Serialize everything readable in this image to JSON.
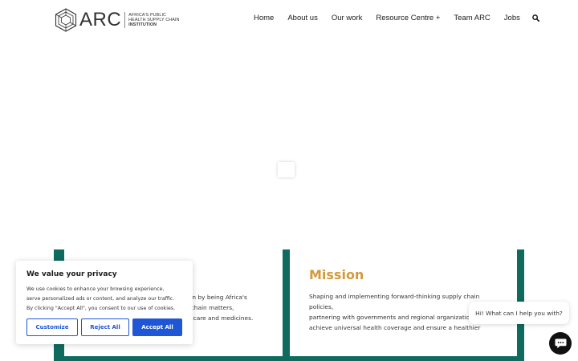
{
  "header": {
    "logo": {
      "word": "ARC",
      "tagline_line1": "AFRICA'S PUBLIC",
      "tagline_line2": "HEALTH SUPPLY CHAIN",
      "tagline_line3": "INSTITUTION"
    },
    "nav": {
      "items": [
        {
          "label": "Home"
        },
        {
          "label": "About us"
        },
        {
          "label": "Our work"
        },
        {
          "label": "Resource Centre +"
        },
        {
          "label": "Team ARC"
        },
        {
          "label": "Jobs"
        }
      ],
      "search_icon": "search-icon"
    }
  },
  "vision": {
    "line1": "son by being Africa's",
    "line2": "y chain matters,",
    "line3": "lthcare and medicines."
  },
  "mission": {
    "title": "Mission",
    "line1": "Shaping and implementing forward-thinking supply chain policies,",
    "line2": "partnering with governments and regional organizations t",
    "line3": "achieve universal health coverage and ensure a healthier"
  },
  "cookie": {
    "title": "We value your privacy",
    "line1": "We use cookies to enhance your browsing experience,",
    "line2": "serve personalized ads or content, and analyze our traffic.",
    "line3": "By clicking \"Accept All\", you consent to our use of cookies.",
    "customize_label": "Customize",
    "reject_label": "Reject All",
    "accept_label": "Accept All"
  },
  "chat": {
    "greeting": "Hi! What can I help you with?",
    "icon": "chat-icon"
  },
  "colors": {
    "brand_green": "#0e6b5e",
    "mission_gold": "#d39a3a",
    "button_blue": "#1e56d6"
  }
}
